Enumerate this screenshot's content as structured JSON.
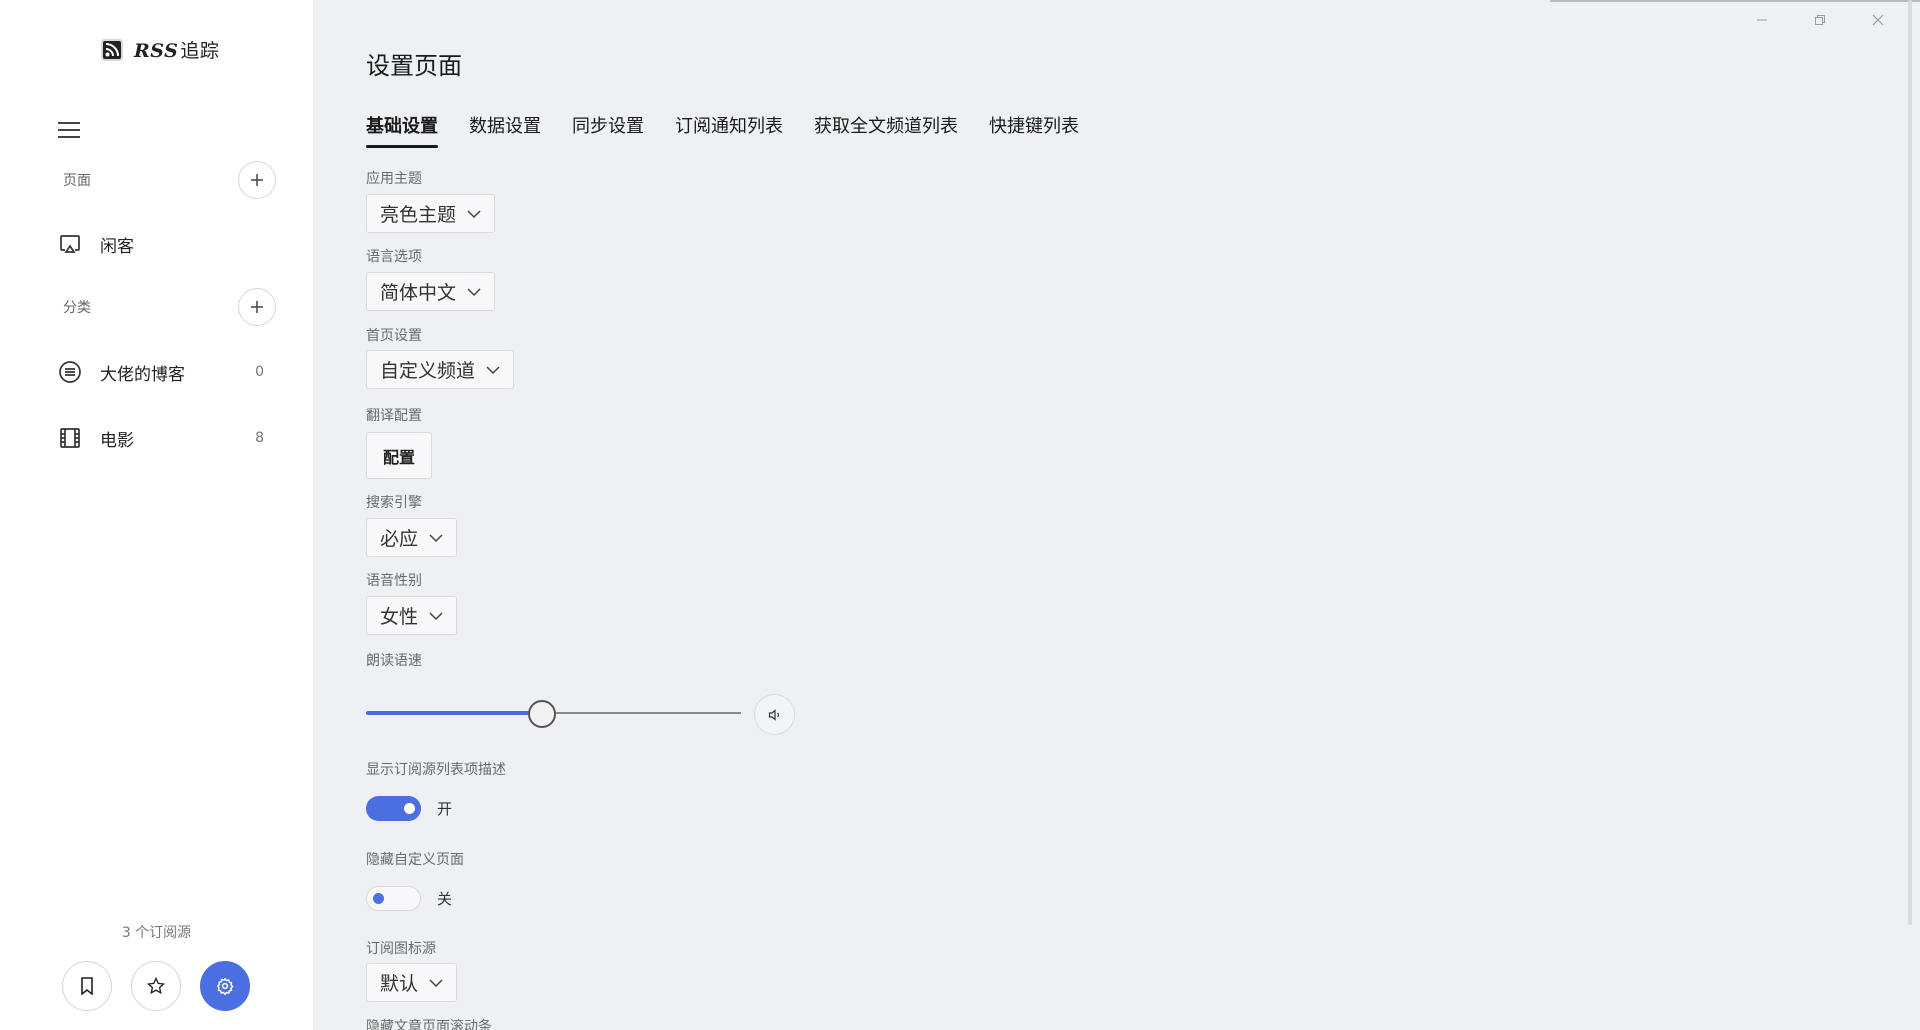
{
  "app": {
    "name_prefix": "RSS",
    "name_suffix": "追踪"
  },
  "sidebar": {
    "pages_label": "页面",
    "pages": [
      {
        "label": "闲客",
        "icon": "cast-icon"
      }
    ],
    "categories_label": "分类",
    "categories": [
      {
        "label": "大佬的博客",
        "count": "0",
        "icon": "list-circle-icon"
      },
      {
        "label": "电影",
        "count": "8",
        "icon": "film-icon"
      }
    ],
    "subscription_count": "3 个订阅源",
    "bottom_buttons": [
      "bookmark-icon",
      "star-icon",
      "gear-icon"
    ]
  },
  "main": {
    "title": "设置页面",
    "tabs": [
      {
        "label": "基础设置",
        "active": true
      },
      {
        "label": "数据设置"
      },
      {
        "label": "同步设置"
      },
      {
        "label": "订阅通知列表"
      },
      {
        "label": "获取全文频道列表"
      },
      {
        "label": "快捷键列表"
      }
    ],
    "theme": {
      "label": "应用主题",
      "value": "亮色主题"
    },
    "language": {
      "label": "语言选项",
      "value": "简体中文"
    },
    "homepage": {
      "label": "首页设置",
      "value": "自定义频道"
    },
    "translate": {
      "label": "翻译配置",
      "button": "配置"
    },
    "search_engine": {
      "label": "搜索引擎",
      "value": "必应"
    },
    "voice_gender": {
      "label": "语音性别",
      "value": "女性"
    },
    "reading_speed": {
      "label": "朗读语速",
      "value_fraction": 0.47
    },
    "show_description": {
      "label": "显示订阅源列表项描述",
      "state": "开",
      "on": true
    },
    "hide_custom_page": {
      "label": "隐藏自定义页面",
      "state": "关",
      "on": false
    },
    "feed_icon_source": {
      "label": "订阅图标源",
      "value": "默认"
    },
    "hide_scrollbar": {
      "label": "隐藏文章页面滚动条"
    }
  },
  "colors": {
    "accent": "#4b6fe0",
    "sidebar_bg": "#ffffff",
    "main_bg": "#eef0f4"
  }
}
